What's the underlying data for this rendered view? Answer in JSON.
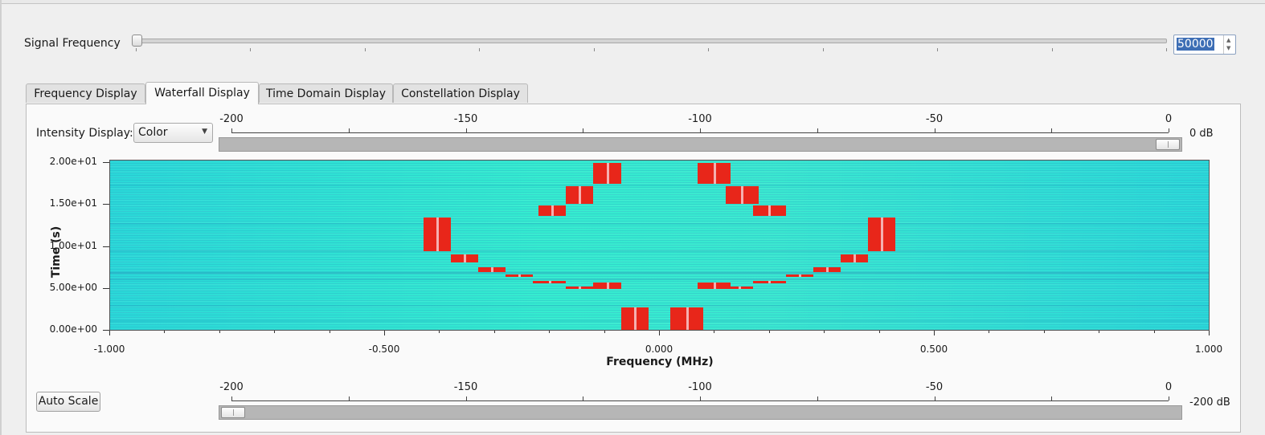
{
  "signal": {
    "label": "Signal Frequency",
    "value": "50000",
    "slider_fraction": 0.0
  },
  "tabs": [
    {
      "label": "Frequency Display",
      "active": false
    },
    {
      "label": "Waterfall Display",
      "active": true
    },
    {
      "label": "Time Domain Display",
      "active": false
    },
    {
      "label": "Constellation Display",
      "active": false
    }
  ],
  "intensity": {
    "label": "Intensity Display:",
    "selected": "Color"
  },
  "top_scale": {
    "ticks": [
      "-200",
      "-150",
      "-100",
      "-50",
      "0"
    ],
    "value_label": "0 dB",
    "value_db": 0
  },
  "bottom_scale": {
    "ticks": [
      "-200",
      "-150",
      "-100",
      "-50",
      "0"
    ],
    "value_label": "-200 dB",
    "value_db": -200
  },
  "plot": {
    "y_title": "Time (s)",
    "y_ticks": [
      "2.00e+01",
      "1.50e+01",
      "1.00e+01",
      "5.00e+00",
      "0.00e+00"
    ],
    "x_title": "Frequency (MHz)",
    "x_ticks": [
      "-1.000",
      "-0.500",
      "0.000",
      "0.500",
      "1.000"
    ]
  },
  "chart_data": {
    "type": "heatmap",
    "title": "",
    "xlabel": "Frequency (MHz)",
    "ylabel": "Time (s)",
    "xlim": [
      -1.0,
      1.0
    ],
    "ylim": [
      0,
      20
    ],
    "colormap": "Color",
    "signals": [
      {
        "f0": -0.07,
        "f1": -0.02,
        "t0": 0.0,
        "t1": 2.8
      },
      {
        "f0": 0.02,
        "f1": 0.08,
        "t0": 0.0,
        "t1": 2.8
      },
      {
        "f0": -0.12,
        "f1": -0.07,
        "t0": 5.0,
        "t1": 5.7
      },
      {
        "f0": 0.07,
        "f1": 0.13,
        "t0": 5.0,
        "t1": 5.7
      },
      {
        "f0": -0.17,
        "f1": -0.12,
        "t0": 5.0,
        "t1": 5.3
      },
      {
        "f0": 0.12,
        "f1": 0.17,
        "t0": 5.0,
        "t1": 5.3
      },
      {
        "f0": -0.23,
        "f1": -0.17,
        "t0": 5.6,
        "t1": 5.9
      },
      {
        "f0": 0.17,
        "f1": 0.23,
        "t0": 5.6,
        "t1": 5.9
      },
      {
        "f0": -0.28,
        "f1": -0.23,
        "t0": 6.4,
        "t1": 6.7
      },
      {
        "f0": 0.23,
        "f1": 0.28,
        "t0": 6.4,
        "t1": 6.7
      },
      {
        "f0": -0.33,
        "f1": -0.28,
        "t0": 7.0,
        "t1": 7.6
      },
      {
        "f0": 0.28,
        "f1": 0.33,
        "t0": 7.0,
        "t1": 7.6
      },
      {
        "f0": -0.38,
        "f1": -0.33,
        "t0": 8.1,
        "t1": 9.1
      },
      {
        "f0": 0.33,
        "f1": 0.38,
        "t0": 8.1,
        "t1": 9.1
      },
      {
        "f0": -0.43,
        "f1": -0.38,
        "t0": 9.5,
        "t1": 13.5
      },
      {
        "f0": 0.38,
        "f1": 0.43,
        "t0": 9.5,
        "t1": 13.5
      },
      {
        "f0": -0.22,
        "f1": -0.17,
        "t0": 13.7,
        "t1": 14.9
      },
      {
        "f0": 0.17,
        "f1": 0.23,
        "t0": 13.7,
        "t1": 14.9
      },
      {
        "f0": -0.17,
        "f1": -0.12,
        "t0": 15.1,
        "t1": 17.2
      },
      {
        "f0": 0.12,
        "f1": 0.18,
        "t0": 15.1,
        "t1": 17.2
      },
      {
        "f0": -0.12,
        "f1": -0.07,
        "t0": 17.5,
        "t1": 20.0
      },
      {
        "f0": 0.07,
        "f1": 0.13,
        "t0": 17.5,
        "t1": 20.0
      }
    ]
  }
}
